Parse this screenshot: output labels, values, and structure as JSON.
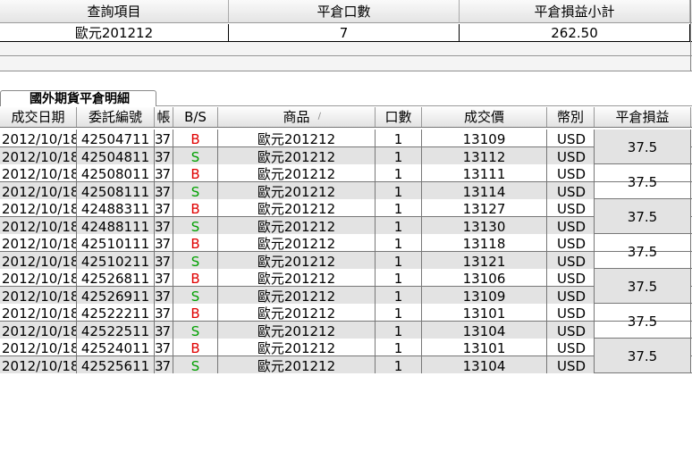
{
  "summary": {
    "headers": [
      "查詢項目",
      "平倉口數",
      "平倉損益小計"
    ],
    "row": [
      "歐元201212",
      "7",
      "262.50"
    ]
  },
  "tab": {
    "label": "國外期貨平倉明細"
  },
  "detail": {
    "headers": [
      "成交日期",
      "委託編號",
      "帳",
      "B/S",
      "商品",
      "口數",
      "成交價",
      "幣別",
      "平倉損益"
    ],
    "rows": [
      [
        "2012/10/18",
        "42504711",
        "37",
        "B",
        "歐元201212",
        "1",
        "13109",
        "USD"
      ],
      [
        "2012/10/18",
        "42504811",
        "37",
        "S",
        "歐元201212",
        "1",
        "13112",
        "USD"
      ],
      [
        "2012/10/18",
        "42508011",
        "37",
        "B",
        "歐元201212",
        "1",
        "13111",
        "USD"
      ],
      [
        "2012/10/18",
        "42508111",
        "37",
        "S",
        "歐元201212",
        "1",
        "13114",
        "USD"
      ],
      [
        "2012/10/18",
        "42488311",
        "37",
        "B",
        "歐元201212",
        "1",
        "13127",
        "USD"
      ],
      [
        "2012/10/18",
        "42488111",
        "37",
        "S",
        "歐元201212",
        "1",
        "13130",
        "USD"
      ],
      [
        "2012/10/18",
        "42510111",
        "37",
        "B",
        "歐元201212",
        "1",
        "13118",
        "USD"
      ],
      [
        "2012/10/18",
        "42510211",
        "37",
        "S",
        "歐元201212",
        "1",
        "13121",
        "USD"
      ],
      [
        "2012/10/18",
        "42526811",
        "37",
        "B",
        "歐元201212",
        "1",
        "13106",
        "USD"
      ],
      [
        "2012/10/18",
        "42526911",
        "37",
        "S",
        "歐元201212",
        "1",
        "13109",
        "USD"
      ],
      [
        "2012/10/18",
        "42522211",
        "37",
        "B",
        "歐元201212",
        "1",
        "13101",
        "USD"
      ],
      [
        "2012/10/18",
        "42522511",
        "37",
        "S",
        "歐元201212",
        "1",
        "13104",
        "USD"
      ],
      [
        "2012/10/18",
        "42524011",
        "37",
        "B",
        "歐元201212",
        "1",
        "13101",
        "USD"
      ],
      [
        "2012/10/18",
        "42525611",
        "37",
        "S",
        "歐元201212",
        "1",
        "13104",
        "USD"
      ]
    ],
    "pl": [
      "37.5",
      "37.5",
      "37.5",
      "37.5",
      "37.5",
      "37.5",
      "37.5"
    ]
  },
  "colors": {
    "buy": "#e00000",
    "sell": "#00a000",
    "alt_row": "#e3e3e3"
  }
}
